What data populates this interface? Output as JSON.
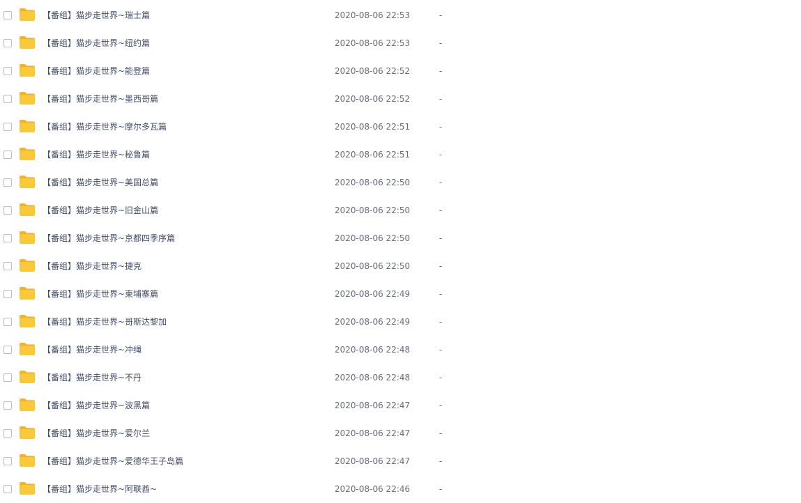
{
  "colors": {
    "folder": "#f9c93a",
    "folder_tab": "#f2b51d",
    "checkbox_border": "#b7bdc9",
    "text": "#424e67",
    "muted_text": "#636d7e"
  },
  "icons": {
    "row_icon": "folder-icon"
  },
  "files": [
    {
      "name": "【番组】猫步走世界~瑞士篇",
      "time": "2020-08-06 22:53",
      "size": "-"
    },
    {
      "name": "【番组】猫步走世界~纽约篇",
      "time": "2020-08-06 22:53",
      "size": "-"
    },
    {
      "name": "【番组】猫步走世界~能登篇",
      "time": "2020-08-06 22:52",
      "size": "-"
    },
    {
      "name": "【番组】猫步走世界~墨西哥篇",
      "time": "2020-08-06 22:52",
      "size": "-"
    },
    {
      "name": "【番组】猫步走世界~摩尔多瓦篇",
      "time": "2020-08-06 22:51",
      "size": "-"
    },
    {
      "name": "【番组】猫步走世界~秘鲁篇",
      "time": "2020-08-06 22:51",
      "size": "-"
    },
    {
      "name": "【番组】猫步走世界~美国总篇",
      "time": "2020-08-06 22:50",
      "size": "-"
    },
    {
      "name": "【番组】猫步走世界~旧金山篇",
      "time": "2020-08-06 22:50",
      "size": "-"
    },
    {
      "name": "【番组】猫步走世界~京都四季序篇",
      "time": "2020-08-06 22:50",
      "size": "-"
    },
    {
      "name": "【番组】猫步走世界~捷克",
      "time": "2020-08-06 22:50",
      "size": "-"
    },
    {
      "name": "【番组】猫步走世界~柬埔寨篇",
      "time": "2020-08-06 22:49",
      "size": "-"
    },
    {
      "name": "【番组】猫步走世界~哥斯达黎加",
      "time": "2020-08-06 22:49",
      "size": "-"
    },
    {
      "name": "【番组】猫步走世界~冲绳",
      "time": "2020-08-06 22:48",
      "size": "-"
    },
    {
      "name": "【番组】猫步走世界~不丹",
      "time": "2020-08-06 22:48",
      "size": "-"
    },
    {
      "name": "【番组】猫步走世界~波黑篇",
      "time": "2020-08-06 22:47",
      "size": "-"
    },
    {
      "name": "【番组】猫步走世界~爱尔兰",
      "time": "2020-08-06 22:47",
      "size": "-"
    },
    {
      "name": "【番组】猫步走世界~爱德华王子岛篇",
      "time": "2020-08-06 22:47",
      "size": "-"
    },
    {
      "name": "【番组】猫步走世界~阿联酋~",
      "time": "2020-08-06 22:46",
      "size": "-"
    }
  ]
}
